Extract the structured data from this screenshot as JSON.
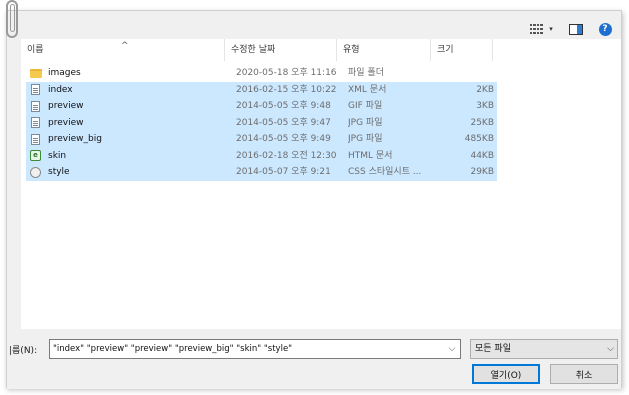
{
  "toolbar": {
    "view_icon": "list-view-icon",
    "view_dropdown_icon": "chevron-down-icon",
    "preview_pane_icon": "preview-pane-icon",
    "help_icon": "help-icon",
    "help_glyph": "?",
    "view_arrow_glyph": "▾"
  },
  "columns": {
    "name": "이름",
    "date": "수정한 날짜",
    "type": "유형",
    "size": "크기",
    "sort_glyph": "^"
  },
  "files": [
    {
      "name": "images",
      "date": "2020-05-18 오후 11:16",
      "type": "파일 폴더",
      "size": "",
      "icon": "folder-icon",
      "selected": false
    },
    {
      "name": "index",
      "date": "2016-02-15 오후 10:22",
      "type": "XML 문서",
      "size": "2KB",
      "icon": "xml-file-icon",
      "selected": true
    },
    {
      "name": "preview",
      "date": "2014-05-05 오후 9:48",
      "type": "GIF 파일",
      "size": "3KB",
      "icon": "image-file-icon",
      "selected": true
    },
    {
      "name": "preview",
      "date": "2014-05-05 오후 9:47",
      "type": "JPG 파일",
      "size": "25KB",
      "icon": "image-file-icon",
      "selected": true
    },
    {
      "name": "preview_big",
      "date": "2014-05-05 오후 9:49",
      "type": "JPG 파일",
      "size": "485KB",
      "icon": "image-file-icon",
      "selected": true
    },
    {
      "name": "skin",
      "date": "2016-02-18 오전 12:30",
      "type": "HTML 문서",
      "size": "44KB",
      "icon": "html-file-icon",
      "selected": true
    },
    {
      "name": "style",
      "date": "2014-05-07 오후 9:21",
      "type": "CSS 스타일시트 ...",
      "size": "29KB",
      "icon": "css-file-icon",
      "selected": true
    }
  ],
  "bottom": {
    "filename_label": "|름(N):",
    "filename_value": "\"index\" \"preview\" \"preview\" \"preview_big\" \"skin\" \"style\"",
    "filetype_value": "모든 파일",
    "dropdown_glyph": "⌵",
    "open_label": "열기(O)",
    "cancel_label": "취소"
  },
  "colors": {
    "selection": "#cce8ff",
    "accent": "#0078d7",
    "help": "#1f6fd1"
  }
}
